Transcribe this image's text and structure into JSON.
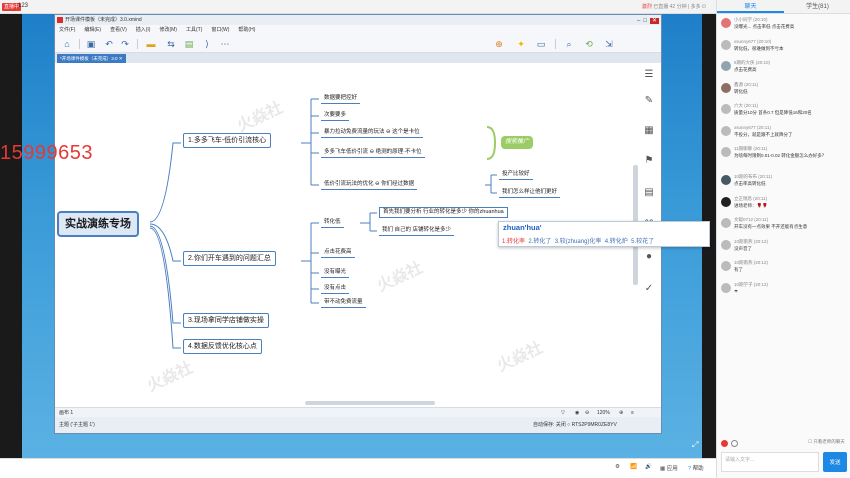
{
  "topbar": {
    "live_badge": "直播中",
    "room_id": "123",
    "status": "已直播 42 分钟  | 多多  ⏻",
    "status_alert": "激烈"
  },
  "window": {
    "title": "开场课件模板（未完成）3.0.xmind",
    "menu": [
      "文件(F)",
      "编辑(E)",
      "查看(V)",
      "插入(I)",
      "修改(M)",
      "工具(T)",
      "窗口(W)",
      "帮助(H)"
    ],
    "doc_tab": "*开场课件模板（未完成）3.0 ✕",
    "statusbar_left": "画布 1",
    "statusbar_right": "120%",
    "topic_info": "主题 ('子主题 1')",
    "autosave": "自动保存: 关闭  ○ RTS2P9MR0ZE8YV"
  },
  "overlay_phone": "15999653",
  "mindmap": {
    "root": "实战演练专场",
    "branches": [
      "1.多多飞车-低价引流核心",
      "2.你们开车遇到的问题汇总",
      "3.现场拿同学店铺做实操",
      "4.数据反馈优化核心点"
    ],
    "branch1_children": [
      "数据要把控好",
      "次要要多",
      "暴力拉动免费流量的玩法  ⊖   这个是卡位",
      "多多飞车低价引流   ⊖   绝测的原理·不卡位",
      "低价引流玩法的优化   ⊖   你们经过数据"
    ],
    "branch1_sub": [
      "投产比较好",
      "我们怎么样让他们更好"
    ],
    "summary": "搜索推广",
    "branch2_children": [
      "转化低",
      "点击花费高",
      "没有曝光",
      "没有点击",
      "带不动免费流量"
    ],
    "branch2_sub": [
      "首先我们要分析 行业的转化是多少 你的zhuanhua",
      "我们 自己的 店铺转化是多少"
    ]
  },
  "ime": {
    "pinyin": "zhuan'hua'",
    "candidates": [
      "1.转化率",
      "2.转化了",
      "3.较(zhuang)化率",
      "4.转化炉",
      "5.较花了"
    ]
  },
  "chat": {
    "tabs": [
      "聊天",
      "学生(81)"
    ],
    "messages": [
      {
        "name": "小小同学 (20:10)",
        "text": "没曝光... 点击率低 点击花费高"
      },
      {
        "name": "xsunny677 (20:10)",
        "text": "转化低，很难做到不亏本"
      },
      {
        "name": "8期的大侠 (20:10)",
        "text": "点击花费高"
      },
      {
        "name": "鑫源 (20:11)",
        "text": "转化低"
      },
      {
        "name": "六大 (20:11)",
        "text": "质量分10分 首条0.7 但是降低16和20名"
      },
      {
        "name": "xsunny677 (20:11)",
        "text": "不投分，就是跟不上就降分了"
      },
      {
        "name": "11期聊聊 (20:11)",
        "text": "为啥每时限制0.01-0.02 转化金额怎么办好多？"
      },
      {
        "name": "10期的布布 (20:11)",
        "text": "点击率高转化低"
      },
      {
        "name": "立正稍息 (20:11)",
        "text": "进场老师：🌹🌹"
      },
      {
        "name": "文聪0712 (20:11)",
        "text": "开车没有一点效果 不开还能有点生意"
      },
      {
        "name": "10期南燕 (20:12)",
        "text": "没声音了"
      },
      {
        "name": "10期南燕 (20:12)",
        "text": "有了"
      },
      {
        "name": "10期学子 (20:12)",
        "text": "☂"
      }
    ],
    "only_teacher": "只看老师的聊天",
    "input_placeholder": "请输入文字...",
    "send_label": "发送"
  },
  "taskbar": {
    "items": [
      "应用",
      "帮助"
    ]
  }
}
